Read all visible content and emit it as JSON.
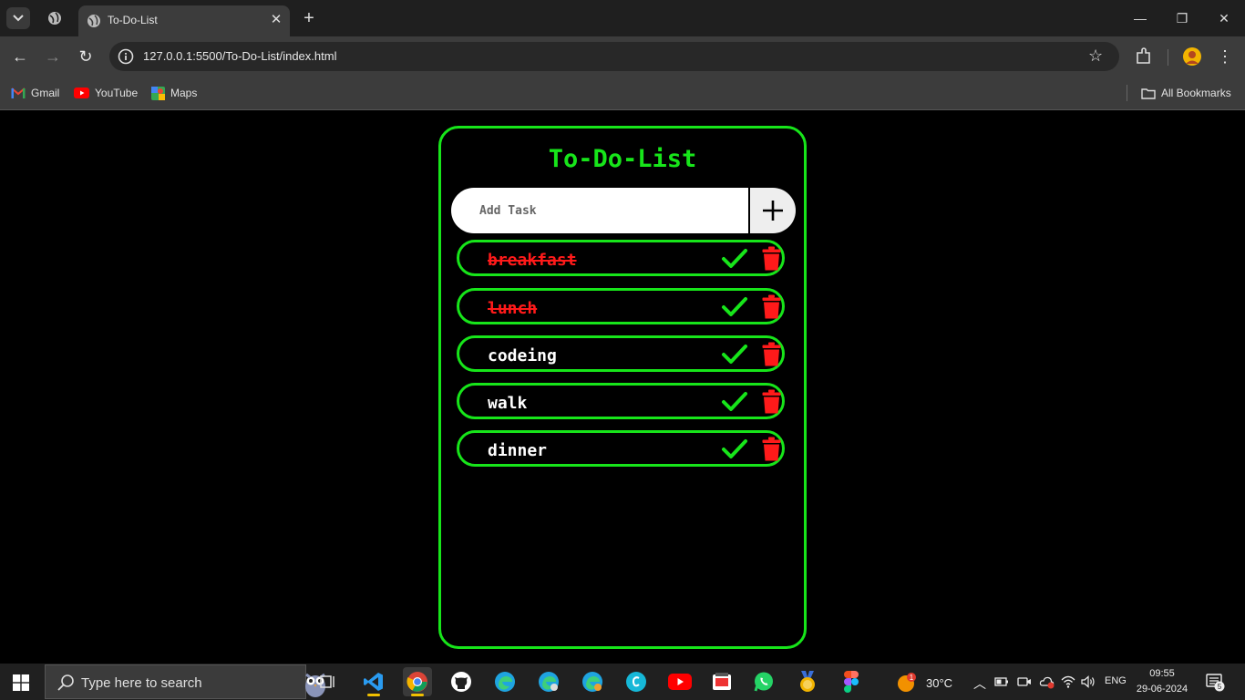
{
  "browser": {
    "tab_title": "To-Do-List",
    "url": "127.0.0.1:5500/To-Do-List/index.html",
    "bookmarks": [
      {
        "label": "Gmail",
        "icon": "gmail-icon"
      },
      {
        "label": "YouTube",
        "icon": "youtube-icon"
      },
      {
        "label": "Maps",
        "icon": "maps-icon"
      }
    ],
    "all_bookmarks_label": "All Bookmarks"
  },
  "app": {
    "title": "To-Do-List",
    "input_placeholder": "Add Task",
    "add_button_icon": "plus-icon",
    "tasks": [
      {
        "text": "breakfast",
        "done": true
      },
      {
        "text": "lunch",
        "done": true
      },
      {
        "text": "codeing",
        "done": false
      },
      {
        "text": "walk",
        "done": false
      },
      {
        "text": "dinner",
        "done": false
      }
    ]
  },
  "taskbar": {
    "search_placeholder": "Type here to search",
    "weather_temp": "30°C",
    "weather_badge": "1",
    "language": "ENG",
    "time": "09:55",
    "date": "29-06-2024",
    "notification_count": "5"
  },
  "colors": {
    "accent_green": "#17e51a",
    "done_red": "#ff1a1a",
    "background": "#000000"
  }
}
